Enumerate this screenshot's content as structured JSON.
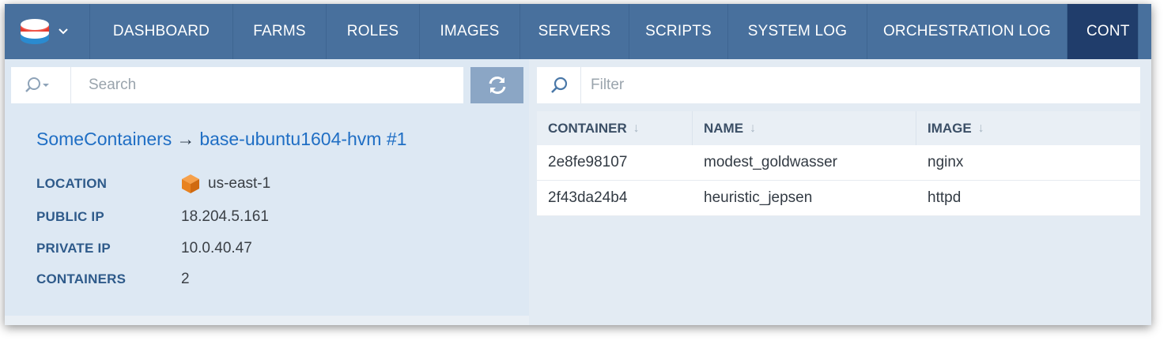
{
  "nav": {
    "items": [
      {
        "label": "DASHBOARD"
      },
      {
        "label": "FARMS"
      },
      {
        "label": "ROLES"
      },
      {
        "label": "IMAGES"
      },
      {
        "label": "SERVERS"
      },
      {
        "label": "SCRIPTS"
      },
      {
        "label": "SYSTEM LOG"
      },
      {
        "label": "ORCHESTRATION LOG"
      },
      {
        "label": "CONT"
      }
    ],
    "active_index": 8
  },
  "left": {
    "search": {
      "placeholder": "Search"
    },
    "title": {
      "farm": "SomeContainers",
      "arrow": "→",
      "server": "base-ubuntu1604-hvm #1"
    },
    "details": [
      {
        "label": "LOCATION",
        "value": "us-east-1",
        "icon": "region-cube-icon"
      },
      {
        "label": "PUBLIC IP",
        "value": "18.204.5.161"
      },
      {
        "label": "PRIVATE IP",
        "value": "10.0.40.47"
      },
      {
        "label": "CONTAINERS",
        "value": "2"
      }
    ]
  },
  "right": {
    "filter": {
      "placeholder": "Filter"
    },
    "columns": [
      "CONTAINER",
      "NAME",
      "IMAGE"
    ],
    "rows": [
      [
        "2e8fe98107",
        "modest_goldwasser",
        "nginx"
      ],
      [
        "2f43da24b4",
        "heuristic_jepsen",
        "httpd"
      ]
    ]
  },
  "colors": {
    "nav_bg": "#48709d",
    "nav_active": "#203d6b",
    "link": "#1f6ec4",
    "label": "#2e5a8a",
    "cube": "#f08a24"
  }
}
